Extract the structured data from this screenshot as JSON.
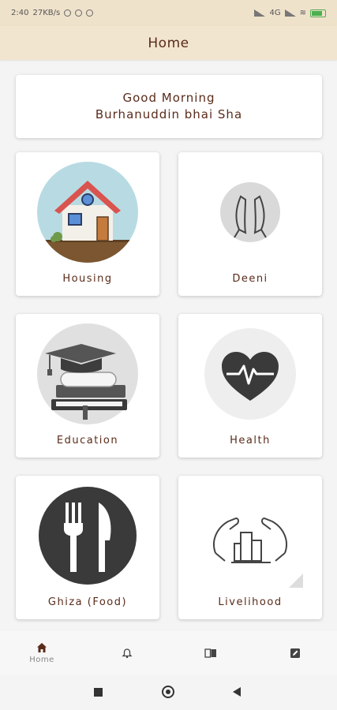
{
  "status_bar": {
    "time": "2:40",
    "speed": "27KB/s",
    "signal_label": "4G"
  },
  "app_bar": {
    "title": "Home"
  },
  "greeting": {
    "line1": "Good Morning",
    "line2": "Burhanuddin bhai Sha"
  },
  "tiles": [
    {
      "label": "Housing",
      "icon": "house-icon"
    },
    {
      "label": "Deeni",
      "icon": "praying-hands-icon"
    },
    {
      "label": "Education",
      "icon": "books-graduation-cap-icon"
    },
    {
      "label": "Health",
      "icon": "heartbeat-icon"
    },
    {
      "label": "Ghiza (Food)",
      "icon": "fork-knife-icon"
    },
    {
      "label": "Livelihood",
      "icon": "hands-building-icon"
    }
  ],
  "bottom_nav": [
    {
      "label": "Home",
      "icon": "home-icon",
      "active": true
    },
    {
      "label": "",
      "icon": "bell-icon",
      "active": false
    },
    {
      "label": "",
      "icon": "book-icon",
      "active": false
    },
    {
      "label": "",
      "icon": "edit-icon",
      "active": false
    }
  ],
  "colors": {
    "accent": "#5a2b1a",
    "app_bar": "#f2e5cf",
    "status_bar": "#efe2cb"
  }
}
